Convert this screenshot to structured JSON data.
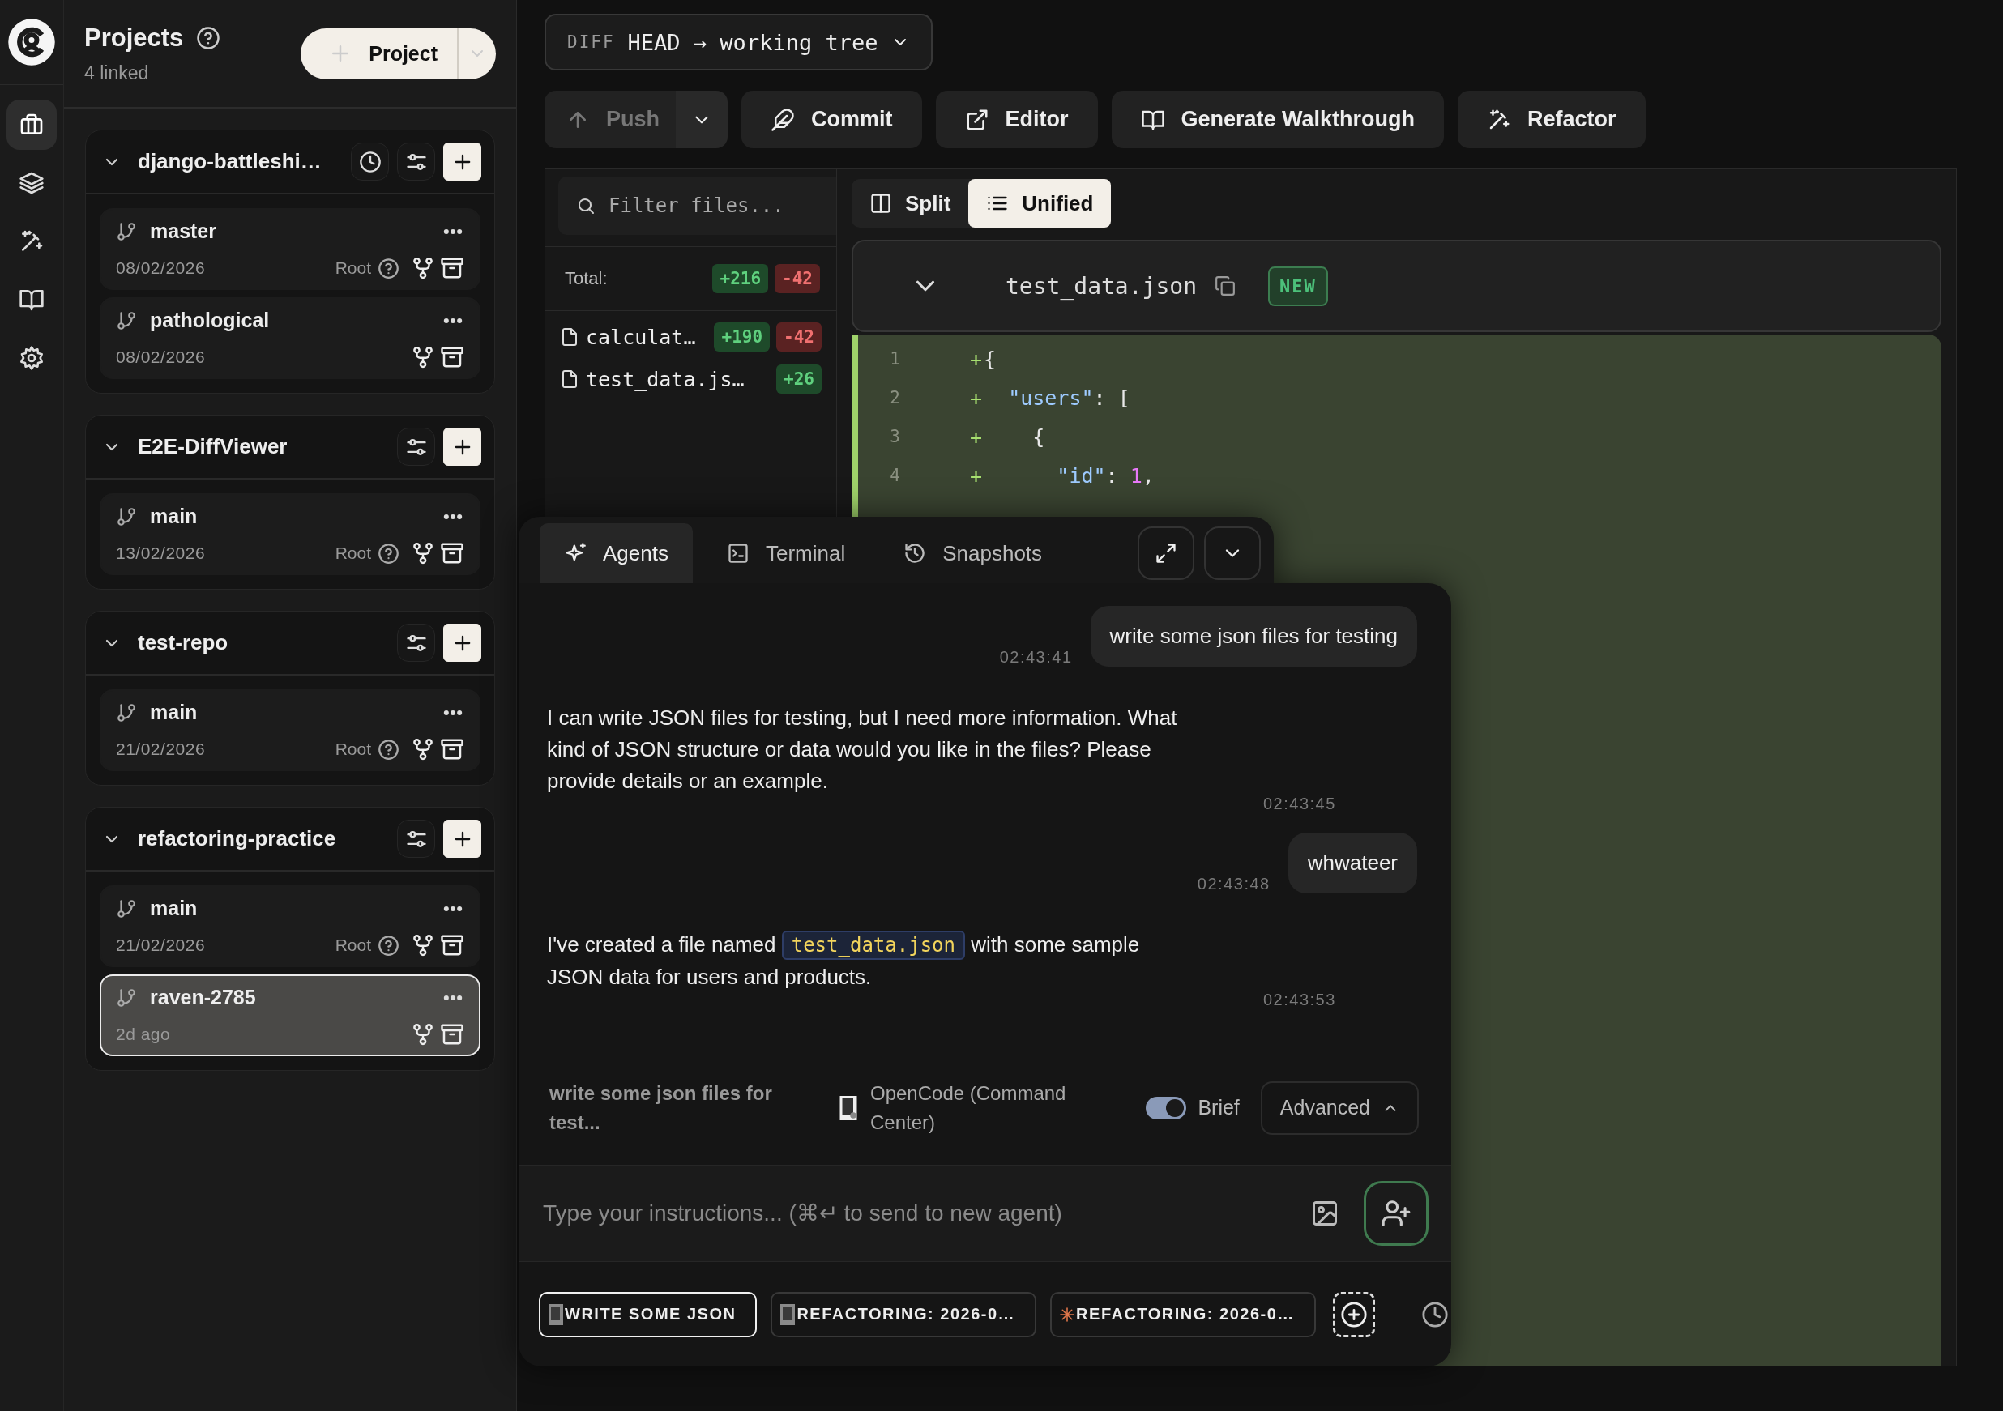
{
  "rail": [
    {
      "selected": true
    },
    {
      "selected": false
    },
    {
      "selected": false
    },
    {
      "selected": false
    },
    {
      "selected": false
    }
  ],
  "sidebar": {
    "title": "Projects",
    "subtitle": "4 linked",
    "new_button": "Project",
    "projects": [
      {
        "name": "django-battleshi…",
        "expanded": true,
        "history": true,
        "branches": [
          {
            "name": "master",
            "date": "08/02/2026",
            "root": "Root",
            "selected": false
          },
          {
            "name": "pathological",
            "date": "08/02/2026",
            "selected": false
          }
        ]
      },
      {
        "name": "E2E-DiffViewer",
        "expanded": true,
        "history": false,
        "branches": [
          {
            "name": "main",
            "date": "13/02/2026",
            "root": "Root",
            "selected": false
          }
        ]
      },
      {
        "name": "test-repo",
        "expanded": true,
        "history": false,
        "branches": [
          {
            "name": "main",
            "date": "21/02/2026",
            "root": "Root",
            "selected": false
          }
        ]
      },
      {
        "name": "refactoring-practice",
        "expanded": true,
        "history": false,
        "branches": [
          {
            "name": "main",
            "date": "21/02/2026",
            "root": "Root",
            "selected": false
          },
          {
            "name": "raven-2785",
            "date": "2d ago",
            "selected": true
          }
        ]
      }
    ]
  },
  "diff_selector": {
    "label": "DIFF",
    "value": "HEAD → working tree"
  },
  "toolbar": {
    "push": {
      "label": "Push",
      "disabled": true
    },
    "buttons": [
      {
        "label": "Commit"
      },
      {
        "label": "Editor"
      },
      {
        "label": "Generate Walkthrough"
      },
      {
        "label": "Refactor"
      }
    ]
  },
  "files": {
    "filter_placeholder": "Filter files...",
    "total_label": "Total:",
    "total_added": "+216",
    "total_removed": "-42",
    "items": [
      {
        "name": "calculat…",
        "added": "+190",
        "removed": "-42"
      },
      {
        "name": "test_data.js…",
        "added": "+26"
      }
    ]
  },
  "view_modes": [
    {
      "label": "Split",
      "selected": false
    },
    {
      "label": "Unified",
      "selected": true
    }
  ],
  "file_header": {
    "name": "test_data.json",
    "badge": "NEW"
  },
  "code_lines": [
    {
      "number": "1",
      "tokens": [
        {
          "kind": "plus",
          "text": "+"
        },
        {
          "kind": "punct",
          "text": "{"
        }
      ]
    },
    {
      "number": "2",
      "tokens": [
        {
          "kind": "plus",
          "text": "+"
        },
        {
          "kind": "key",
          "text": "  \"users\""
        },
        {
          "kind": "punct",
          "text": ": ["
        }
      ]
    },
    {
      "number": "3",
      "tokens": [
        {
          "kind": "plus",
          "text": "+"
        },
        {
          "kind": "punct",
          "text": "    {"
        }
      ]
    },
    {
      "number": "4",
      "tokens": [
        {
          "kind": "plus",
          "text": "+"
        },
        {
          "kind": "key",
          "text": "      \"id\""
        },
        {
          "kind": "punct",
          "text": ": "
        },
        {
          "kind": "num",
          "text": "1"
        },
        {
          "kind": "punct",
          "text": ","
        }
      ]
    }
  ],
  "agent_panel": {
    "tabs": [
      {
        "label": "Agents",
        "selected": true
      },
      {
        "label": "Terminal",
        "selected": false
      },
      {
        "label": "Snapshots",
        "selected": false
      }
    ],
    "messages": [
      {
        "kind": "user",
        "time": "02:43:41",
        "parts": [
          {
            "kind": "text",
            "text": "write some json files for testing"
          }
        ]
      },
      {
        "kind": "assistant",
        "time": "02:43:45",
        "parts": [
          {
            "kind": "text",
            "text": "I can write JSON files for testing, but I need more information. What kind of JSON structure or data would you like in the files? Please provide details or an example."
          }
        ]
      },
      {
        "kind": "user",
        "time": "02:43:48",
        "parts": [
          {
            "kind": "text",
            "text": "whwateer"
          }
        ]
      },
      {
        "kind": "assistant",
        "time": "02:43:53",
        "parts": [
          {
            "kind": "text",
            "text": "I've created a file named "
          },
          {
            "kind": "code",
            "text": "test_data.json"
          },
          {
            "kind": "text",
            "text": " with some sample JSON data for users and products."
          }
        ]
      }
    ],
    "settings": {
      "task": "write some json files for test...",
      "agent": "OpenCode (Command Center)",
      "brief": {
        "label": "Brief",
        "on": true
      },
      "advanced": "Advanced"
    },
    "input": {
      "placeholder": "Type your instructions... (⌘↵ to send to new agent)"
    },
    "sessions": [
      {
        "label": "WRITE SOME JSON",
        "kind": "idle",
        "selected": true
      },
      {
        "label": "REFACTORING: 2026-0…",
        "kind": "idle",
        "selected": false
      },
      {
        "label": "REFACTORING: 2026-0…",
        "kind": "working",
        "selected": false
      }
    ]
  }
}
